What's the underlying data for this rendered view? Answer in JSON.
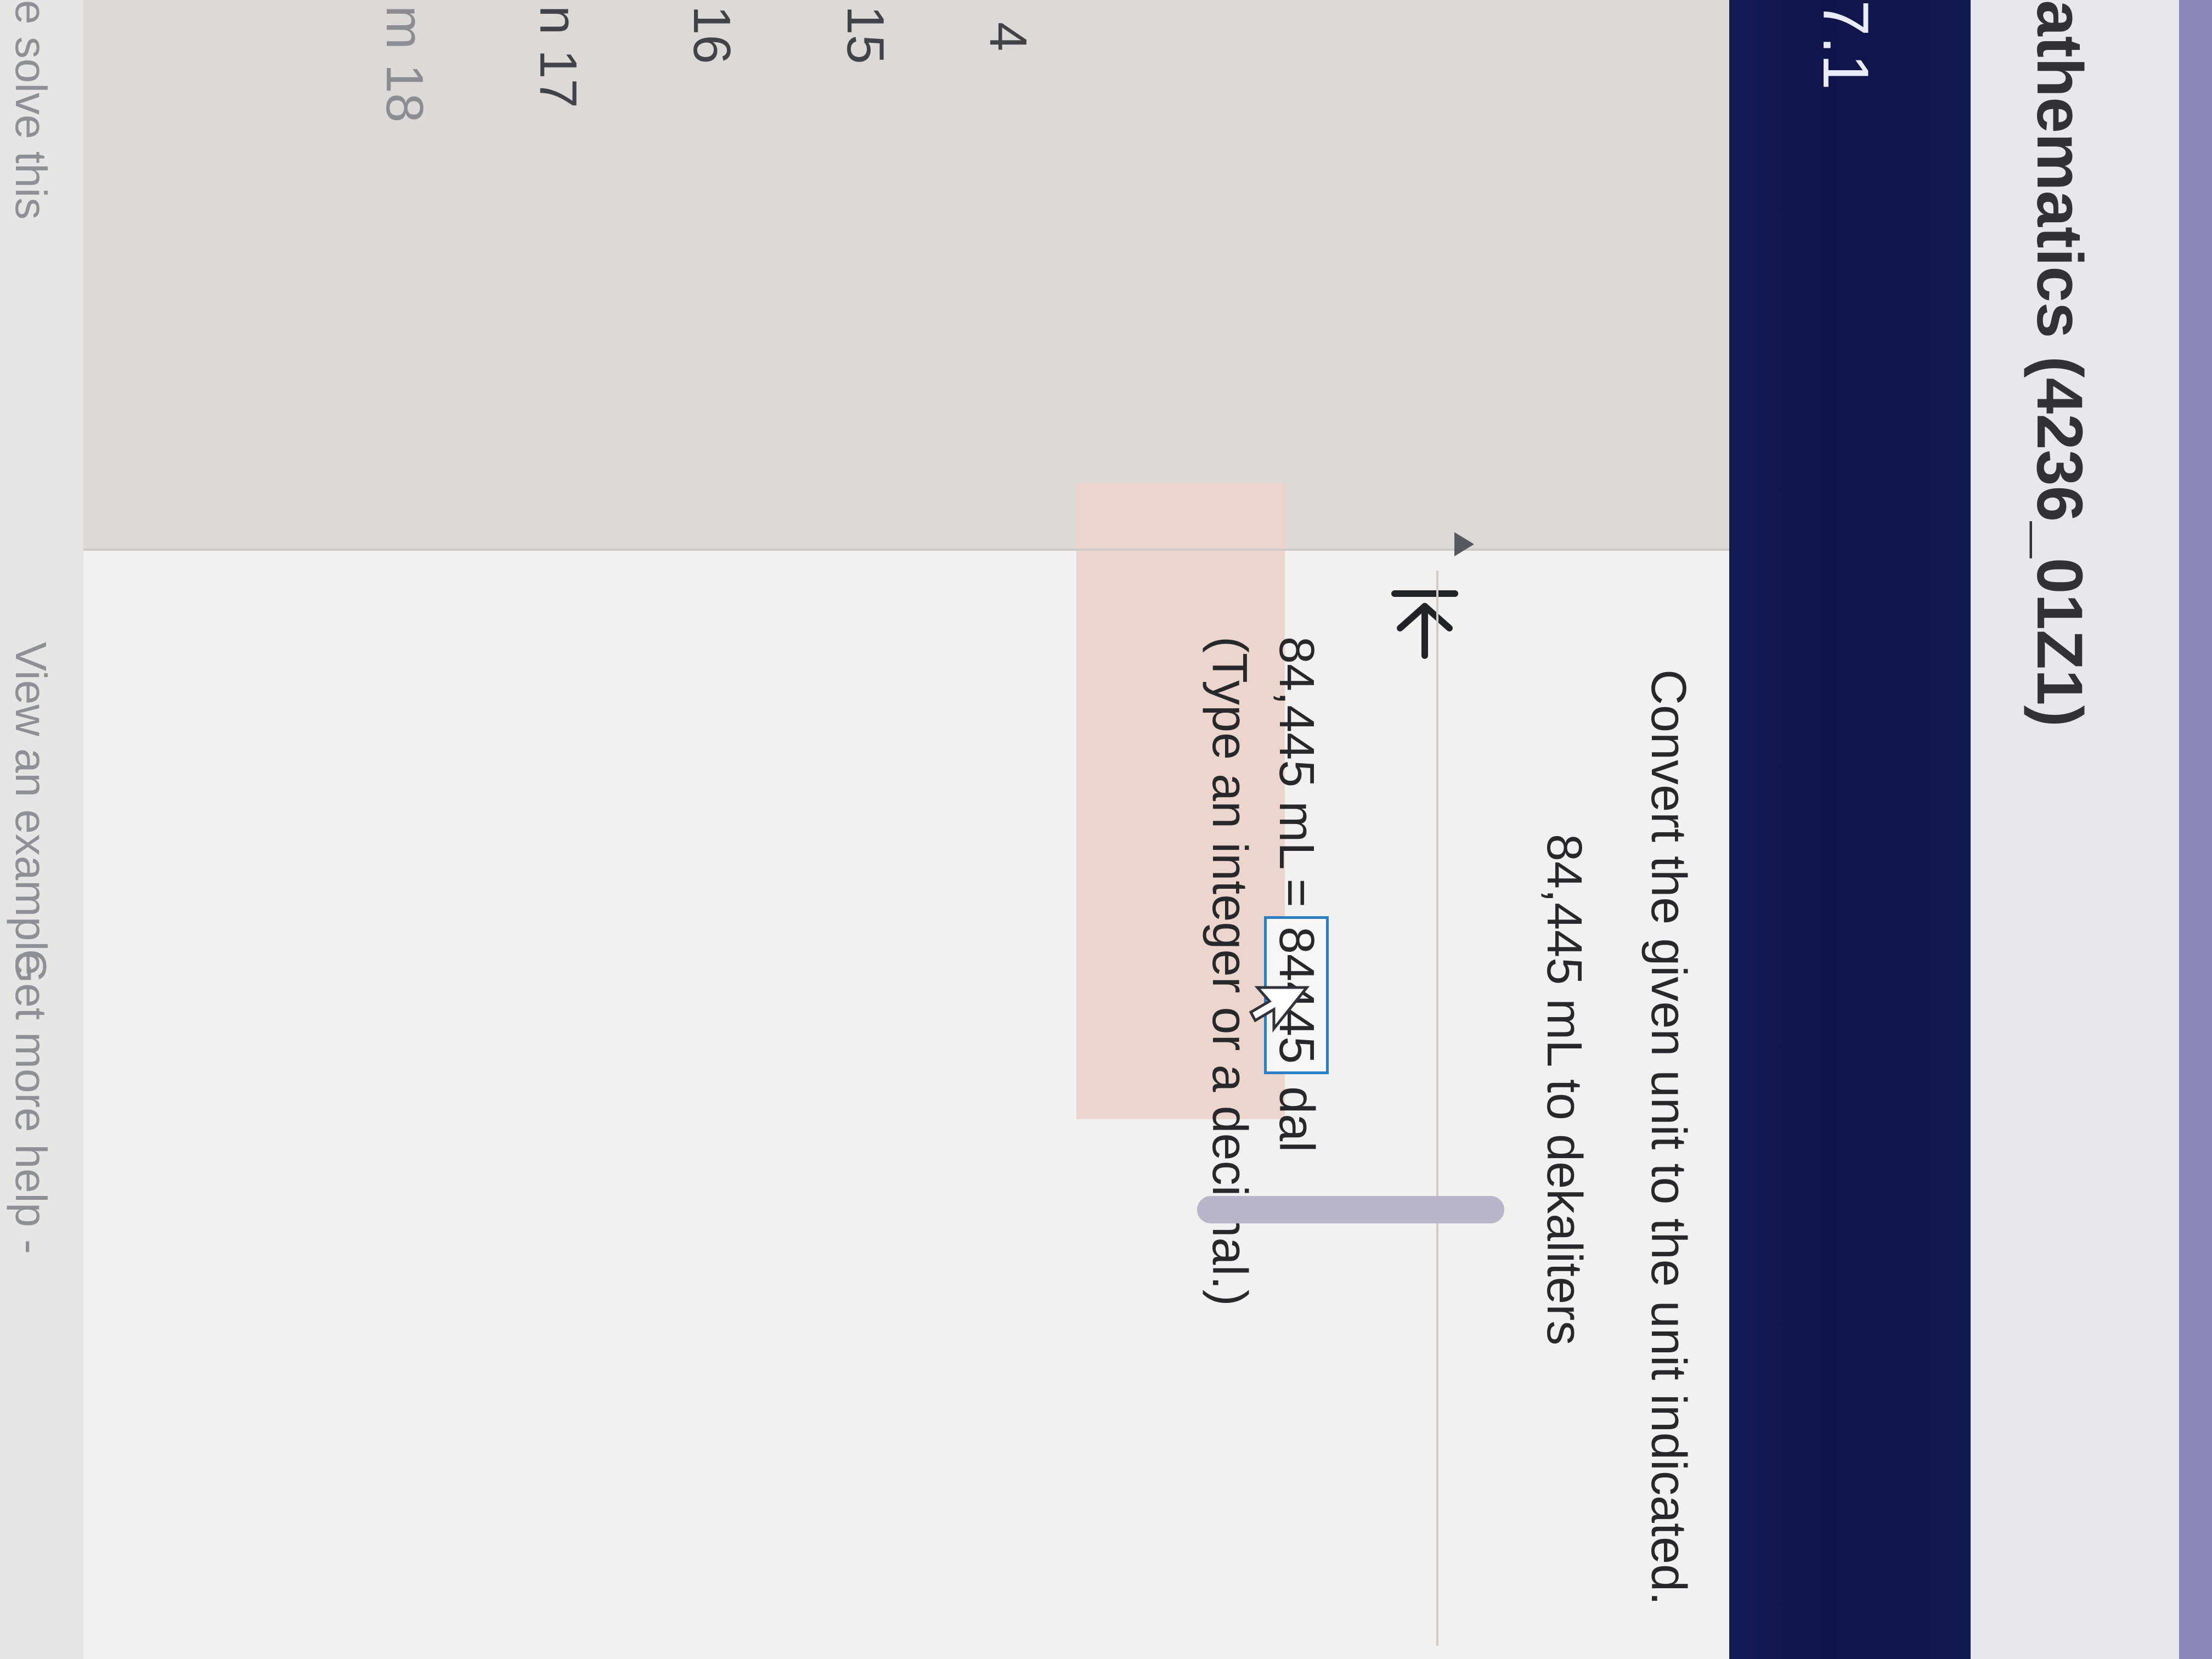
{
  "header": {
    "course_title": "athematics (4236_01Z1)",
    "section": "7.1"
  },
  "sidebar": {
    "items": [
      "4",
      "15",
      "16",
      "n 17",
      "m 18"
    ]
  },
  "question": {
    "instruction": "Convert the given unit to the unit indicated.",
    "given": "84,445 mL to dekaliters",
    "answer_prefix": "84,445 mL",
    "equals": "=",
    "answer_value": "84445",
    "answer_unit": "dal",
    "hint": "(Type an integer or a decimal.)"
  },
  "footer": {
    "help_solve": "e solve this",
    "view_example": "View an example",
    "more_help": "Get more help -"
  },
  "colors": {
    "nav_bar": "#121a52",
    "input_border": "#2b7fc4",
    "highlight": "#ecd5cc"
  },
  "icons": {
    "back": "back-to-start-icon",
    "cursor": "mouse-cursor-icon"
  }
}
